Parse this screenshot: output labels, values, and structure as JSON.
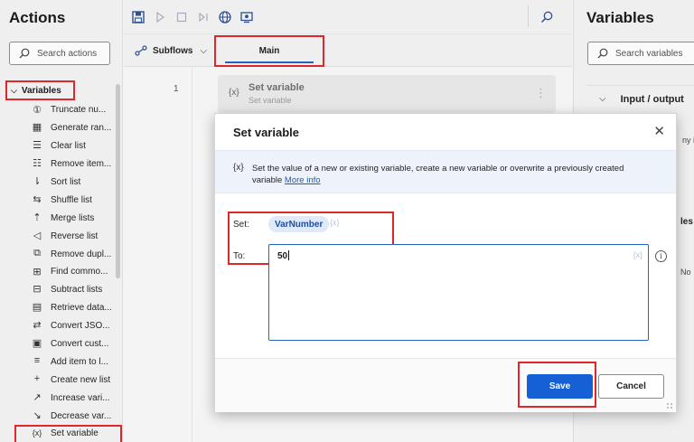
{
  "actions_panel": {
    "title": "Actions",
    "search_placeholder": "Search actions",
    "group_label": "Variables",
    "items": [
      {
        "icon": "number-circle-icon",
        "label": "Truncate nu..."
      },
      {
        "icon": "random-grid-icon",
        "label": "Generate ran..."
      },
      {
        "icon": "list-clear-icon",
        "label": "Clear list"
      },
      {
        "icon": "list-remove-icon",
        "label": "Remove item..."
      },
      {
        "icon": "sort-icon",
        "label": "Sort list"
      },
      {
        "icon": "shuffle-icon",
        "label": "Shuffle list"
      },
      {
        "icon": "merge-icon",
        "label": "Merge lists"
      },
      {
        "icon": "reverse-icon",
        "label": "Reverse list"
      },
      {
        "icon": "remove-duplicates-icon",
        "label": "Remove dupl..."
      },
      {
        "icon": "find-common-icon",
        "label": "Find commo..."
      },
      {
        "icon": "subtract-icon",
        "label": "Subtract lists"
      },
      {
        "icon": "datatable-icon",
        "label": "Retrieve data..."
      },
      {
        "icon": "convert-json-icon",
        "label": "Convert JSO..."
      },
      {
        "icon": "js-icon",
        "label": "Convert cust..."
      },
      {
        "icon": "add-item-icon",
        "label": "Add item to l..."
      },
      {
        "icon": "plus-icon",
        "label": "Create new list"
      },
      {
        "icon": "increase-icon",
        "label": "Increase vari..."
      },
      {
        "icon": "decrease-icon",
        "label": "Decrease var..."
      },
      {
        "icon": "variable-braces-icon",
        "label": "Set variable"
      }
    ]
  },
  "editor": {
    "subflows_label": "Subflows",
    "main_tab_label": "Main",
    "line_number": "1",
    "step_icon": "{x}",
    "step_title": "Set variable",
    "step_subtitle": "Set variable"
  },
  "variables_panel": {
    "title": "Variables",
    "search_placeholder": "Search variables",
    "io_section_label": "Input / output",
    "fragment_1": "ny i",
    "fragment_2": "les",
    "fragment_3": "No"
  },
  "dialog": {
    "title": "Set variable",
    "close_glyph": "✕",
    "info_icon": "{x}",
    "info_text": "Set the value of a new or existing variable, create a new variable or overwrite a previously created variable",
    "info_link": "More info",
    "set_label": "Set:",
    "variable_name": "VarNumber",
    "var_picker_glyph": "{x}",
    "to_label": "To:",
    "to_value": "50",
    "to_picker_glyph": "{x}",
    "to_info_glyph": "i",
    "save_label": "Save",
    "cancel_label": "Cancel"
  },
  "colors": {
    "accent": "#1660d6",
    "highlight": "#e0262c"
  }
}
